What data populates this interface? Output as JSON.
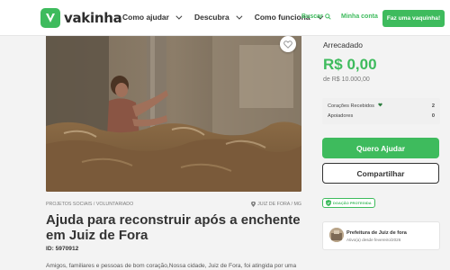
{
  "header": {
    "logo_text": "vakinha",
    "nav": [
      {
        "label": "Como ajudar"
      },
      {
        "label": "Descubra"
      },
      {
        "label": "Como funciona"
      }
    ],
    "search_label": "Buscar",
    "my_campaigns_label": "Minha conta",
    "cta_label": "Faz uma vaquinha!"
  },
  "campaign": {
    "category": "Projetos sociais / Voluntariado",
    "location": "Juiz de Fora / MG",
    "title": "Ajuda para reconstruir após a enchente em Juiz de Fora",
    "id_label": "ID: 5970912",
    "description_preview": "Amigos, familiares e pessoas de bom coração,Nossa cidade, Juiz de Fora, foi atingida por uma"
  },
  "sidebar": {
    "raised_label": "Arrecadado",
    "raised_value": "R$ 0,00",
    "goal_label": "de R$ 10.000,00",
    "stats": [
      {
        "label": "Corações Recebidos",
        "value": "2"
      },
      {
        "label": "Apoiadores",
        "value": "0"
      }
    ],
    "primary_button": "Quero Ajudar",
    "secondary_button": "Compartilhar",
    "protected_badge": "Doação protegida",
    "organizer": {
      "name": "Prefeitura de Juiz de fora",
      "since": "Ativo(a) desde fevereiro/2026"
    }
  },
  "colors": {
    "brand_green": "#3ebb5d",
    "text_dark": "#333333",
    "background": "#f3f3f3"
  }
}
